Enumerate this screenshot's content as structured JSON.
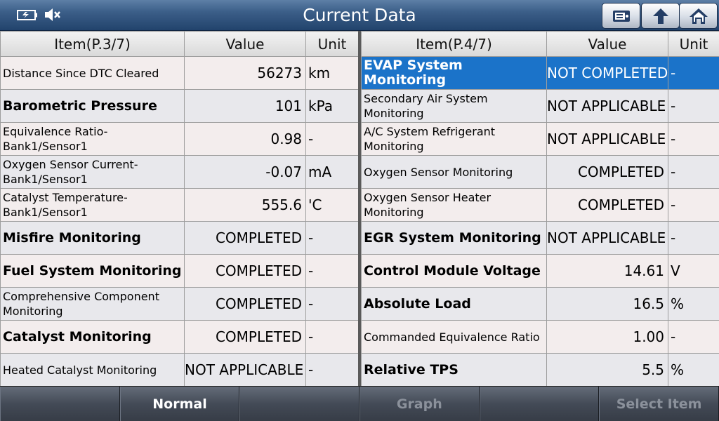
{
  "header": {
    "title": "Current Data",
    "battery_icon": "battery-icon",
    "mute_icon": "speaker-mute-icon",
    "buttons": [
      "print-icon",
      "up-arrow-icon",
      "home-icon"
    ]
  },
  "left_table": {
    "headers": {
      "item": "Item(P.3/7)",
      "value": "Value",
      "unit": "Unit"
    },
    "rows": [
      {
        "item": "Distance Since DTC Cleared",
        "value": "56273",
        "unit": "km"
      },
      {
        "item": "Barometric Pressure",
        "value": "101",
        "unit": "kPa"
      },
      {
        "item": "Equivalence Ratio-Bank1/Sensor1",
        "value": "0.98",
        "unit": "-"
      },
      {
        "item": "Oxygen Sensor Current-Bank1/Sensor1",
        "value": "-0.07",
        "unit": "mA"
      },
      {
        "item": "Catalyst Temperature-Bank1/Sensor1",
        "value": "555.6",
        "unit": "'C"
      },
      {
        "item": "Misfire Monitoring",
        "value": "COMPLETED",
        "unit": "-"
      },
      {
        "item": "Fuel System Monitoring",
        "value": "COMPLETED",
        "unit": "-"
      },
      {
        "item": "Comprehensive Component Monitoring",
        "value": "COMPLETED",
        "unit": "-"
      },
      {
        "item": "Catalyst Monitoring",
        "value": "COMPLETED",
        "unit": "-"
      },
      {
        "item": "Heated Catalyst Monitoring",
        "value": "NOT APPLICABLE",
        "unit": "-"
      }
    ]
  },
  "right_table": {
    "headers": {
      "item": "Item(P.4/7)",
      "value": "Value",
      "unit": "Unit"
    },
    "rows": [
      {
        "item": "EVAP System Monitoring",
        "value": "NOT COMPLETED",
        "unit": "-"
      },
      {
        "item": "Secondary Air System Monitoring",
        "value": "NOT APPLICABLE",
        "unit": "-"
      },
      {
        "item": "A/C System Refrigerant Monitoring",
        "value": "NOT APPLICABLE",
        "unit": "-"
      },
      {
        "item": "Oxygen Sensor Monitoring",
        "value": "COMPLETED",
        "unit": "-"
      },
      {
        "item": "Oxygen Sensor Heater Monitoring",
        "value": "COMPLETED",
        "unit": "-"
      },
      {
        "item": "EGR System Monitoring",
        "value": "NOT APPLICABLE",
        "unit": "-"
      },
      {
        "item": "Control Module Voltage",
        "value": "14.61",
        "unit": "V"
      },
      {
        "item": "Absolute Load",
        "value": "16.5",
        "unit": "%"
      },
      {
        "item": "Commanded Equivalence Ratio",
        "value": "1.00",
        "unit": "-"
      },
      {
        "item": "Relative TPS",
        "value": "5.5",
        "unit": "%"
      }
    ]
  },
  "footer": {
    "buttons": [
      "",
      "Normal",
      "",
      "Graph",
      "",
      "Select Item"
    ]
  },
  "colors": {
    "selected_row": "#1b73c9",
    "title_bar": "#2f5580"
  }
}
